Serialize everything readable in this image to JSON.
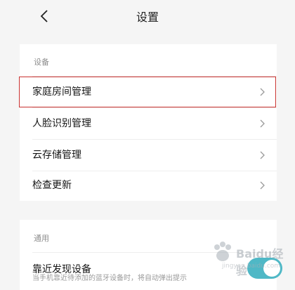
{
  "header": {
    "title": "设置"
  },
  "sections": [
    {
      "label": "设备",
      "items": [
        {
          "label": "家庭房间管理"
        },
        {
          "label": "人脸识别管理"
        },
        {
          "label": "云存储管理"
        },
        {
          "label": "检查更新"
        }
      ]
    },
    {
      "label": "通用",
      "items": [
        {
          "label": "靠近发现设备",
          "description": "当手机靠近待添加的蓝牙设备时，将自动弹出提示",
          "toggle_on": true
        }
      ]
    }
  ],
  "watermark": {
    "text": "Baidu经验",
    "sub": "jingyan.baidu.com"
  },
  "colors": {
    "highlight": "#c9312f",
    "toggle": "#4fb8c6"
  }
}
